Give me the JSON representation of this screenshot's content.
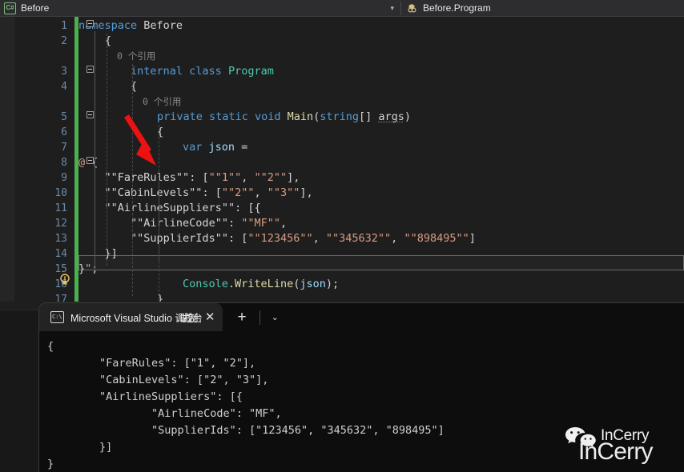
{
  "topbar": {
    "file_tab_label": "Before",
    "file_icon": "csharp-file-icon",
    "dropdown_caret": "▾",
    "member_icon": "class-member-icon",
    "member_label": "Before.Program"
  },
  "editor": {
    "codemap_icon": "code-structure-icon",
    "lightbulb_icon": "quick-actions-lightbulb-icon",
    "line_numbers": [
      "1",
      "2",
      "3",
      "4",
      "5",
      "6",
      "7",
      "8",
      "9",
      "10",
      "11",
      "12",
      "13",
      "14",
      "15",
      "16",
      "17"
    ],
    "codelens": [
      {
        "text": "0 个引用",
        "line": 2
      },
      {
        "text": "0 个引用",
        "line": 4
      }
    ],
    "lines": [
      {
        "n": 1,
        "tokens": [
          {
            "t": "namespace ",
            "c": "kw"
          },
          {
            "t": "Before",
            "c": "plain"
          }
        ],
        "indent": 0
      },
      {
        "n": 2,
        "tokens": [
          {
            "t": "{",
            "c": "plain"
          }
        ],
        "indent": 1
      },
      {
        "n": 3,
        "tokens": [
          {
            "t": "internal ",
            "c": "kw"
          },
          {
            "t": "class ",
            "c": "kw"
          },
          {
            "t": "Program",
            "c": "type"
          }
        ],
        "indent": 2
      },
      {
        "n": 4,
        "tokens": [
          {
            "t": "{",
            "c": "plain"
          }
        ],
        "indent": 2
      },
      {
        "n": 5,
        "tokens": [
          {
            "t": "private ",
            "c": "kw"
          },
          {
            "t": "static ",
            "c": "kw"
          },
          {
            "t": "void ",
            "c": "kw"
          },
          {
            "t": "Main",
            "c": "meth"
          },
          {
            "t": "(",
            "c": "plain"
          },
          {
            "t": "string",
            "c": "kw"
          },
          {
            "t": "[] ",
            "c": "plain"
          },
          {
            "t": "args",
            "c": "squiggle"
          },
          {
            "t": ")",
            "c": "plain"
          }
        ],
        "indent": 3
      },
      {
        "n": 6,
        "tokens": [
          {
            "t": "{",
            "c": "plain"
          }
        ],
        "indent": 3
      },
      {
        "n": 7,
        "tokens": [
          {
            "t": "var ",
            "c": "kw"
          },
          {
            "t": "json",
            "c": "ident"
          },
          {
            "t": " =",
            "c": "plain"
          }
        ],
        "indent": 4
      },
      {
        "n": 8,
        "tokens": [
          {
            "t": "@",
            "c": "verb"
          },
          {
            "t": "\"",
            "c": "verb"
          },
          {
            "t": "{",
            "c": "plain"
          }
        ],
        "indent": 0
      },
      {
        "n": 9,
        "tokens": [
          {
            "t": "    ",
            "c": "plain"
          },
          {
            "t": "\"\"FareRules\"\"",
            "c": "plain"
          },
          {
            "t": ": [",
            "c": "plain"
          },
          {
            "t": "\"\"1\"\"",
            "c": "str"
          },
          {
            "t": ", ",
            "c": "plain"
          },
          {
            "t": "\"\"2\"\"",
            "c": "str"
          },
          {
            "t": "],",
            "c": "plain"
          }
        ],
        "indent": 0
      },
      {
        "n": 10,
        "tokens": [
          {
            "t": "    ",
            "c": "plain"
          },
          {
            "t": "\"\"CabinLevels\"\"",
            "c": "plain"
          },
          {
            "t": ": [",
            "c": "plain"
          },
          {
            "t": "\"\"2\"\"",
            "c": "str"
          },
          {
            "t": ", ",
            "c": "plain"
          },
          {
            "t": "\"\"3\"\"",
            "c": "str"
          },
          {
            "t": "],",
            "c": "plain"
          }
        ],
        "indent": 0
      },
      {
        "n": 11,
        "tokens": [
          {
            "t": "    ",
            "c": "plain"
          },
          {
            "t": "\"\"AirlineSuppliers\"\"",
            "c": "plain"
          },
          {
            "t": ": [{",
            "c": "plain"
          }
        ],
        "indent": 0
      },
      {
        "n": 12,
        "tokens": [
          {
            "t": "        ",
            "c": "plain"
          },
          {
            "t": "\"\"AirlineCode\"\"",
            "c": "plain"
          },
          {
            "t": ": ",
            "c": "plain"
          },
          {
            "t": "\"\"MF\"\"",
            "c": "str"
          },
          {
            "t": ",",
            "c": "plain"
          }
        ],
        "indent": 0
      },
      {
        "n": 13,
        "tokens": [
          {
            "t": "        ",
            "c": "plain"
          },
          {
            "t": "\"\"SupplierIds\"\"",
            "c": "plain"
          },
          {
            "t": ": [",
            "c": "plain"
          },
          {
            "t": "\"\"123456\"\"",
            "c": "str"
          },
          {
            "t": ", ",
            "c": "plain"
          },
          {
            "t": "\"\"345632\"\"",
            "c": "str"
          },
          {
            "t": ", ",
            "c": "plain"
          },
          {
            "t": "\"\"898495\"\"",
            "c": "str"
          },
          {
            "t": "]",
            "c": "plain"
          }
        ],
        "indent": 0
      },
      {
        "n": 14,
        "tokens": [
          {
            "t": "    }]",
            "c": "plain"
          }
        ],
        "indent": 0
      },
      {
        "n": 15,
        "tokens": [
          {
            "t": "}",
            "c": "plain"
          },
          {
            "t": "\"",
            "c": "verb"
          },
          {
            "t": ";",
            "c": "plain"
          }
        ],
        "indent": 0
      },
      {
        "n": 16,
        "tokens": [
          {
            "t": "Console",
            "c": "type"
          },
          {
            "t": ".",
            "c": "plain"
          },
          {
            "t": "WriteLine",
            "c": "meth"
          },
          {
            "t": "(",
            "c": "plain"
          },
          {
            "t": "json",
            "c": "ident"
          },
          {
            "t": ");",
            "c": "plain"
          }
        ],
        "indent": 4
      },
      {
        "n": 17,
        "tokens": [
          {
            "t": "}",
            "c": "plain"
          }
        ],
        "indent": 3
      }
    ],
    "annotation": {
      "type": "red-arrow",
      "color": "#ee1111"
    }
  },
  "terminal": {
    "tab_icon": "console-window-icon",
    "tab_label_ascii": "Microsoft Visual Studio ",
    "tab_label_cjk": "调试控制台",
    "close_glyph": "✕",
    "new_tab_glyph": "+",
    "chevron_glyph": "⌄",
    "output_lines": [
      "{",
      "        \"FareRules\": [\"1\", \"2\"],",
      "        \"CabinLevels\": [\"2\", \"3\"],",
      "        \"AirlineSuppliers\": [{",
      "                \"AirlineCode\": \"MF\",",
      "                \"SupplierIds\": [\"123456\", \"345632\", \"898495\"]",
      "        }]",
      "}"
    ]
  },
  "watermark": {
    "icon": "wechat-logo-icon",
    "text_small": "InCerry",
    "text_big": "InCerry"
  },
  "colors": {
    "editor_background": "#1e1e1e",
    "topbar_background": "#2d2d30",
    "terminal_background": "#0d0d0d",
    "keyword": "#569cd6",
    "type": "#4ec9b0",
    "method": "#dcdcaa",
    "identifier": "#9cdcfe",
    "string": "#d69d85",
    "plain_text": "#d4d4d4",
    "change_bar": "#4caf50",
    "arrow": "#ee1111"
  }
}
